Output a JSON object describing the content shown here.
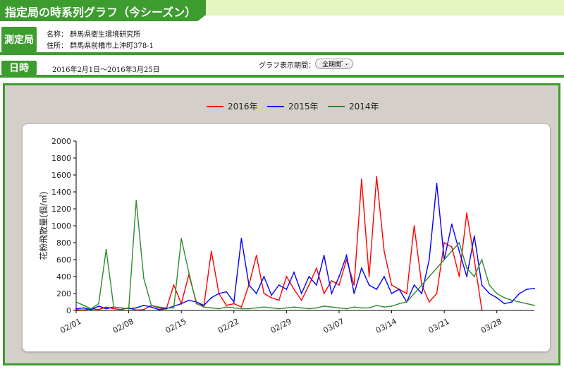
{
  "page": {
    "title": "指定局の時系列グラフ（今シーズン）"
  },
  "station": {
    "label": "測定局",
    "name_line": "名称： 群馬県衛生環境研究所",
    "address_line": "住所： 群馬県前橋市上沖町378-1"
  },
  "period": {
    "label": "日時",
    "value": "2016年2月1日〜2016年3月25日",
    "graph_period_label": "グラフ表示期間：",
    "graph_period_selected": "全期間"
  },
  "colors": {
    "brand_green": "#3c9c2e",
    "series_2016": "#ff0000",
    "series_2015": "#0000ff",
    "series_2014": "#2e8b2e"
  },
  "chart_data": {
    "type": "line",
    "ylabel": "花粉飛散量(個/㎥)",
    "xlabel": "",
    "ylim": [
      0,
      2000
    ],
    "yticks": [
      0,
      200,
      400,
      600,
      800,
      1000,
      1200,
      1400,
      1600,
      1800,
      2000
    ],
    "xlim_days": [
      0,
      61
    ],
    "xtick_labels": [
      "02/01",
      "02/08",
      "02/15",
      "02/22",
      "02/29",
      "03/07",
      "03/14",
      "03/21",
      "03/28"
    ],
    "grid": false,
    "legend_position": "top-center",
    "series": [
      {
        "name": "2016年",
        "color": "#ff0000",
        "x_days": [
          0,
          1,
          2,
          3,
          4,
          5,
          6,
          7,
          8,
          9,
          10,
          11,
          12,
          13,
          14,
          15,
          16,
          17,
          18,
          19,
          20,
          21,
          22,
          23,
          24,
          25,
          26,
          27,
          28,
          29,
          30,
          31,
          32,
          33,
          34,
          35,
          36,
          37,
          38,
          39,
          40,
          41,
          42,
          43,
          44,
          45,
          46,
          47,
          48,
          49,
          50,
          51,
          52,
          53,
          54
        ],
        "values": [
          10,
          5,
          20,
          10,
          40,
          20,
          10,
          30,
          5,
          10,
          60,
          30,
          20,
          300,
          80,
          420,
          100,
          50,
          700,
          200,
          60,
          80,
          40,
          300,
          650,
          200,
          150,
          120,
          400,
          250,
          120,
          300,
          500,
          200,
          350,
          300,
          600,
          300,
          1550,
          400,
          1580,
          700,
          300,
          250,
          200,
          1000,
          300,
          100,
          200,
          800,
          750,
          400,
          1150,
          600,
          10
        ]
      },
      {
        "name": "2015年",
        "color": "#0000ff",
        "x_days": [
          0,
          1,
          2,
          3,
          4,
          5,
          6,
          7,
          8,
          9,
          10,
          11,
          12,
          13,
          14,
          15,
          16,
          17,
          18,
          19,
          20,
          21,
          22,
          23,
          24,
          25,
          26,
          27,
          28,
          29,
          30,
          31,
          32,
          33,
          34,
          35,
          36,
          37,
          38,
          39,
          40,
          41,
          42,
          43,
          44,
          45,
          46,
          47,
          48,
          49,
          50,
          51,
          52,
          53,
          54,
          55,
          56,
          57,
          58,
          59,
          60,
          61
        ],
        "values": [
          20,
          30,
          10,
          50,
          20,
          40,
          30,
          20,
          30,
          60,
          40,
          10,
          20,
          50,
          80,
          120,
          100,
          60,
          150,
          200,
          220,
          100,
          850,
          300,
          200,
          400,
          180,
          300,
          250,
          450,
          200,
          400,
          300,
          650,
          200,
          400,
          650,
          200,
          500,
          300,
          250,
          400,
          200,
          250,
          100,
          300,
          200,
          600,
          1500,
          600,
          1020,
          700,
          400,
          880,
          300,
          200,
          150,
          80,
          100,
          200,
          250,
          260
        ]
      },
      {
        "name": "2014年",
        "color": "#2e8b2e",
        "x_days": [
          0,
          1,
          2,
          3,
          4,
          5,
          6,
          7,
          8,
          9,
          10,
          11,
          12,
          13,
          14,
          15,
          16,
          17,
          18,
          19,
          20,
          21,
          22,
          23,
          24,
          25,
          26,
          27,
          28,
          29,
          30,
          31,
          32,
          33,
          34,
          35,
          36,
          37,
          38,
          39,
          40,
          41,
          42,
          43,
          44,
          45,
          46,
          47,
          48,
          49,
          50,
          51,
          52,
          53,
          54,
          55,
          56,
          57,
          58,
          59,
          60,
          61
        ],
        "values": [
          100,
          60,
          20,
          80,
          720,
          40,
          30,
          20,
          1300,
          380,
          60,
          40,
          30,
          30,
          850,
          450,
          80,
          40,
          30,
          20,
          40,
          30,
          20,
          20,
          30,
          40,
          30,
          20,
          30,
          40,
          30,
          20,
          30,
          50,
          40,
          30,
          20,
          40,
          30,
          30,
          60,
          40,
          50,
          80,
          100,
          200,
          300,
          400,
          500,
          600,
          700,
          800,
          500,
          400,
          600,
          300,
          200,
          150,
          120,
          100,
          80,
          60
        ]
      }
    ]
  }
}
